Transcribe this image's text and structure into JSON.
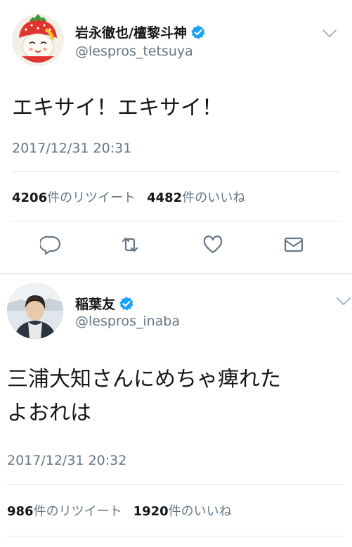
{
  "tweet1": {
    "display_name": "岩永徹也/檀黎斗神",
    "handle": "@lespros_tetsuya",
    "text": "エキサイ！エキサイ！",
    "timestamp": "2017/12/31 20:31",
    "retweet_count": "4206",
    "retweet_label": "件のリツイート",
    "like_count": "4482",
    "like_label": "件のいいね",
    "avatar_icon": "strawberry-character-avatar"
  },
  "tweet2": {
    "display_name": "稲葉友",
    "handle": "@lespros_inaba",
    "text_line1": "三浦大知さんにめちゃ痺れた",
    "text_line2": "よおれは",
    "timestamp": "2017/12/31 20:32",
    "retweet_count": "986",
    "retweet_label": "件のリツイート",
    "like_count": "1920",
    "like_label": "件のいいね",
    "avatar_icon": "person-photo-avatar"
  },
  "colors": {
    "verified": "#1da1f2",
    "secondary_text": "#657786",
    "icon_gray": "#657786",
    "divider": "#e1e8ed"
  },
  "actions": [
    "reply-icon",
    "retweet-icon",
    "like-icon",
    "message-icon"
  ]
}
